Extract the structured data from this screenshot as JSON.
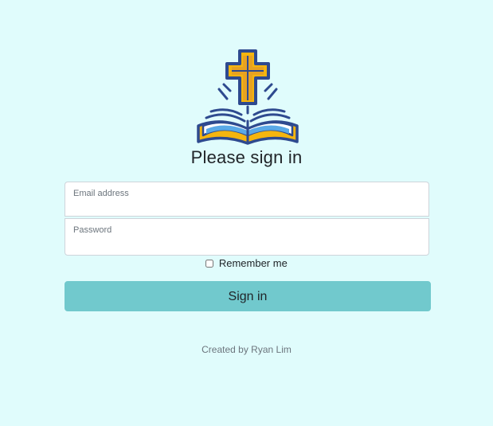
{
  "page": {
    "title": "Please sign in",
    "logo_icon": "cross-and-open-bible-icon"
  },
  "form": {
    "email_label": "Email address",
    "email_value": "",
    "password_label": "Password",
    "password_value": "",
    "remember_label": "Remember me",
    "remember_checked": false,
    "submit_label": "Sign in"
  },
  "footer": {
    "credit": "Created by Ryan Lim"
  },
  "colors": {
    "background": "#e0fcfc",
    "button": "#71c9cd",
    "logo_outline": "#2e4a8f",
    "logo_gold": "#f5b50f",
    "logo_blue": "#5aa9e6"
  }
}
